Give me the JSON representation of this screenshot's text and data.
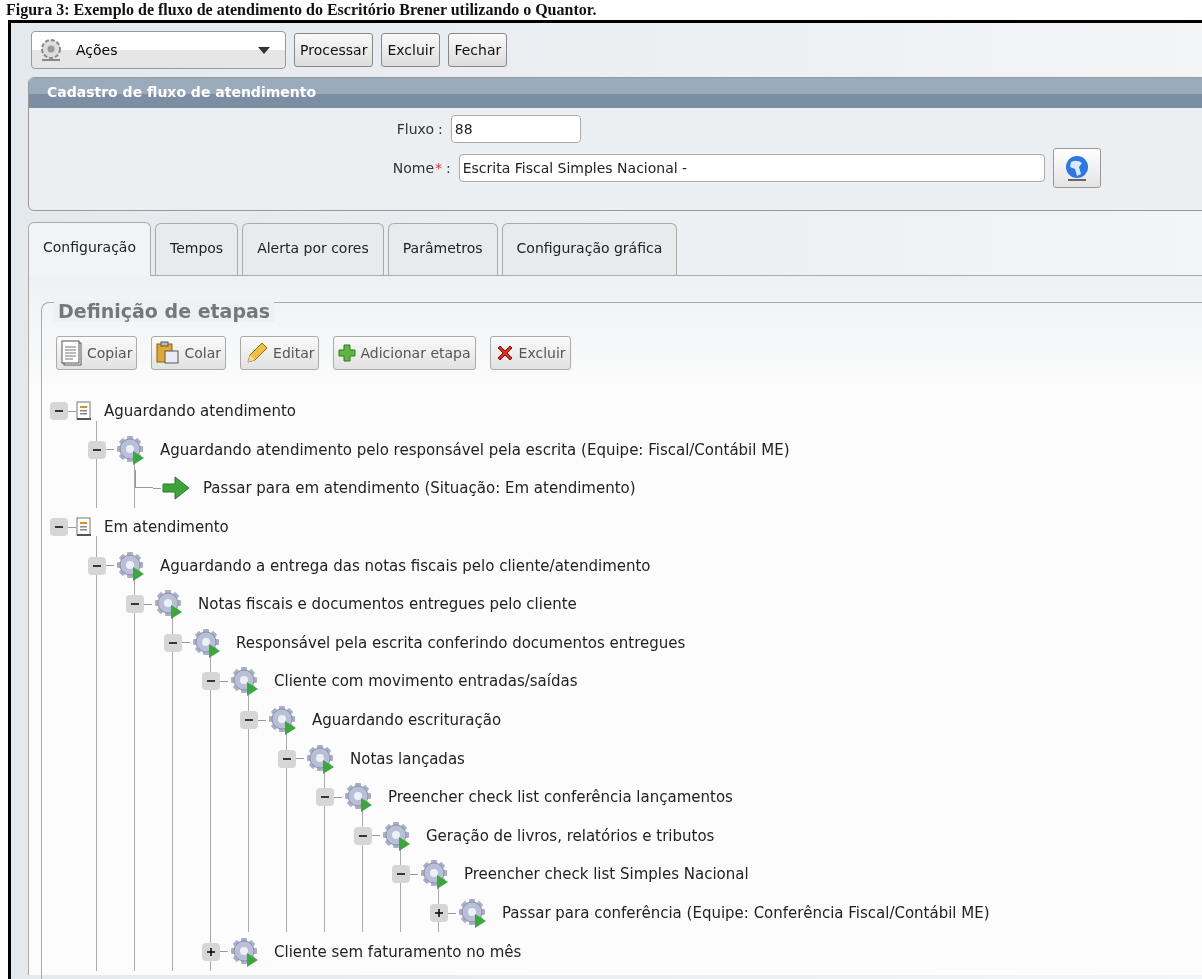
{
  "caption": "Figura 3: Exemplo de fluxo de atendimento do Escritório Brener utilizando o Quantor.",
  "toolbar": {
    "actions": {
      "label": "Ações"
    },
    "buttons": [
      "Processar",
      "Excluir",
      "Fechar"
    ]
  },
  "panel": {
    "title": "Cadastro de fluxo de atendimento",
    "fields": [
      {
        "label": "Fluxo",
        "colon": ":",
        "value": "88",
        "kind": "short"
      },
      {
        "label": "Nome",
        "required_mark": "*",
        "colon": ":",
        "value": "Escrita Fiscal Simples Nacional -",
        "kind": "long"
      }
    ]
  },
  "tabs": [
    {
      "label": "Configuração",
      "selected": true
    },
    {
      "label": "Tempos",
      "selected": false
    },
    {
      "label": "Alerta por cores",
      "selected": false
    },
    {
      "label": "Parâmetros",
      "selected": false
    },
    {
      "label": "Configuração gráfica",
      "selected": false
    }
  ],
  "section": {
    "title": "Definição de etapas",
    "buttons": [
      {
        "label": "Copiar",
        "kind": "copy"
      },
      {
        "label": "Colar",
        "kind": "paste"
      },
      {
        "label": "Editar",
        "kind": "edit"
      },
      {
        "label": "Adicionar etapa",
        "kind": "add"
      },
      {
        "label": "Excluir",
        "kind": "delete"
      }
    ],
    "tree": [
      {
        "label": "Aguardando atendimento",
        "kind": "status",
        "expanded": true,
        "children": [
          {
            "label": "Aguardando atendimento pelo responsável pela escrita (Equipe: Fiscal/Contábil ME)",
            "kind": "step",
            "expanded": true,
            "children": [
              {
                "label": "Passar para em atendimento (Situação: Em atendimento)",
                "kind": "transition"
              }
            ]
          }
        ]
      },
      {
        "label": "Em atendimento",
        "kind": "status",
        "expanded": true,
        "children": [
          {
            "label": "Aguardando a entrega das notas fiscais pelo cliente/atendimento",
            "kind": "step",
            "expanded": true,
            "children": [
              {
                "label": "Notas fiscais e documentos entregues pelo cliente",
                "kind": "step",
                "expanded": true,
                "children": [
                  {
                    "label": "Responsável pela escrita conferindo documentos entregues",
                    "kind": "step",
                    "expanded": true,
                    "children": [
                      {
                        "label": "Cliente com movimento entradas/saídas",
                        "kind": "step",
                        "expanded": true,
                        "children": [
                          {
                            "label": "Aguardando escrituração",
                            "kind": "step",
                            "expanded": true,
                            "children": [
                              {
                                "label": "Notas lançadas",
                                "kind": "step",
                                "expanded": true,
                                "children": [
                                  {
                                    "label": "Preencher check list conferência lançamentos",
                                    "kind": "step",
                                    "expanded": true,
                                    "children": [
                                      {
                                        "label": "Geração de livros, relatórios e tributos",
                                        "kind": "step",
                                        "expanded": true,
                                        "children": [
                                          {
                                            "label": "Preencher check list Simples Nacional",
                                            "kind": "step",
                                            "expanded": true,
                                            "children": [
                                              {
                                                "label": "Passar para conferência (Equipe: Conferência Fiscal/Contábil ME)",
                                                "kind": "step",
                                                "expanded": false
                                              }
                                            ]
                                          }
                                        ]
                                      }
                                    ]
                                  }
                                ]
                              }
                            ]
                          }
                        ]
                      },
                      {
                        "label": "Cliente sem faturamento no mês",
                        "kind": "step",
                        "expanded": false
                      }
                    ]
                  }
                ]
              }
            ]
          }
        ]
      }
    ]
  }
}
